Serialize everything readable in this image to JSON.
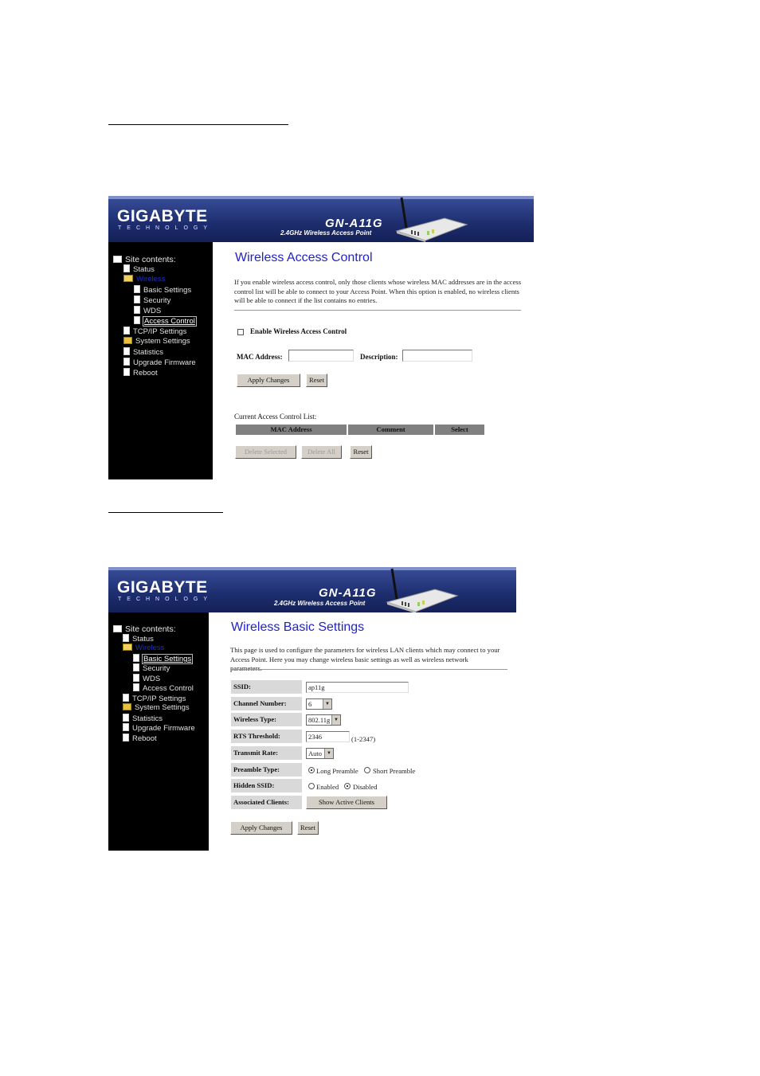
{
  "header": {
    "logo": "GIGABYTE",
    "logo_sub": "TECHNOLOGY",
    "model": "GN-A11G",
    "model_sub": "2.4GHz Wireless Access Point"
  },
  "sidebar": {
    "title": "Site contents:",
    "items": [
      "Status",
      "Wireless",
      "Basic Settings",
      "Security",
      "WDS",
      "Access Control",
      "TCP/IP Settings",
      "System Settings",
      "Statistics",
      "Upgrade Firmware",
      "Reboot"
    ]
  },
  "access_control": {
    "title": "Wireless Access Control",
    "description": "If you enable wireless access control, only those clients whose wireless MAC addresses are in the access control list will be able to connect to your Access Point. When this option is enabled, no wireless clients will be able to connect if the list contains no entries.",
    "enable_label": "Enable Wireless Access Control",
    "enable_checked": false,
    "mac_label": "MAC Address:",
    "mac_value": "",
    "desc_label": "Description:",
    "desc_value": "",
    "apply_button": "Apply Changes",
    "reset_button": "Reset",
    "list_title": "Current Access Control List:",
    "columns": [
      "MAC Address",
      "Comment",
      "Select"
    ],
    "delete_selected": "Delete Selected",
    "delete_all": "Delete All",
    "reset_button2": "Reset"
  },
  "basic_settings": {
    "title": "Wireless Basic Settings",
    "description": "This page is used to configure the parameters for wireless LAN clients which may connect to your Access Point. Here you may change wireless basic settings as well as wireless network parameters.",
    "ssid_label": "SSID:",
    "ssid_value": "ap11g",
    "channel_label": "Channel Number:",
    "channel_value": "6",
    "wtype_label": "Wireless Type:",
    "wtype_value": "802.11g",
    "rts_label": "RTS Threshold:",
    "rts_value": "2346",
    "rts_range": "(1-2347)",
    "rate_label": "Transmit Rate:",
    "rate_value": "Auto",
    "preamble_label": "Preamble Type:",
    "preamble_long": "Long Preamble",
    "preamble_short": "Short Preamble",
    "preamble_selected": "Long Preamble",
    "hidden_label": "Hidden SSID:",
    "hidden_enabled": "Enabled",
    "hidden_disabled": "Disabled",
    "hidden_selected": "Disabled",
    "clients_label": "Associated Clients:",
    "clients_button": "Show Active Clients",
    "apply_button": "Apply Changes",
    "reset_button": "Reset"
  }
}
